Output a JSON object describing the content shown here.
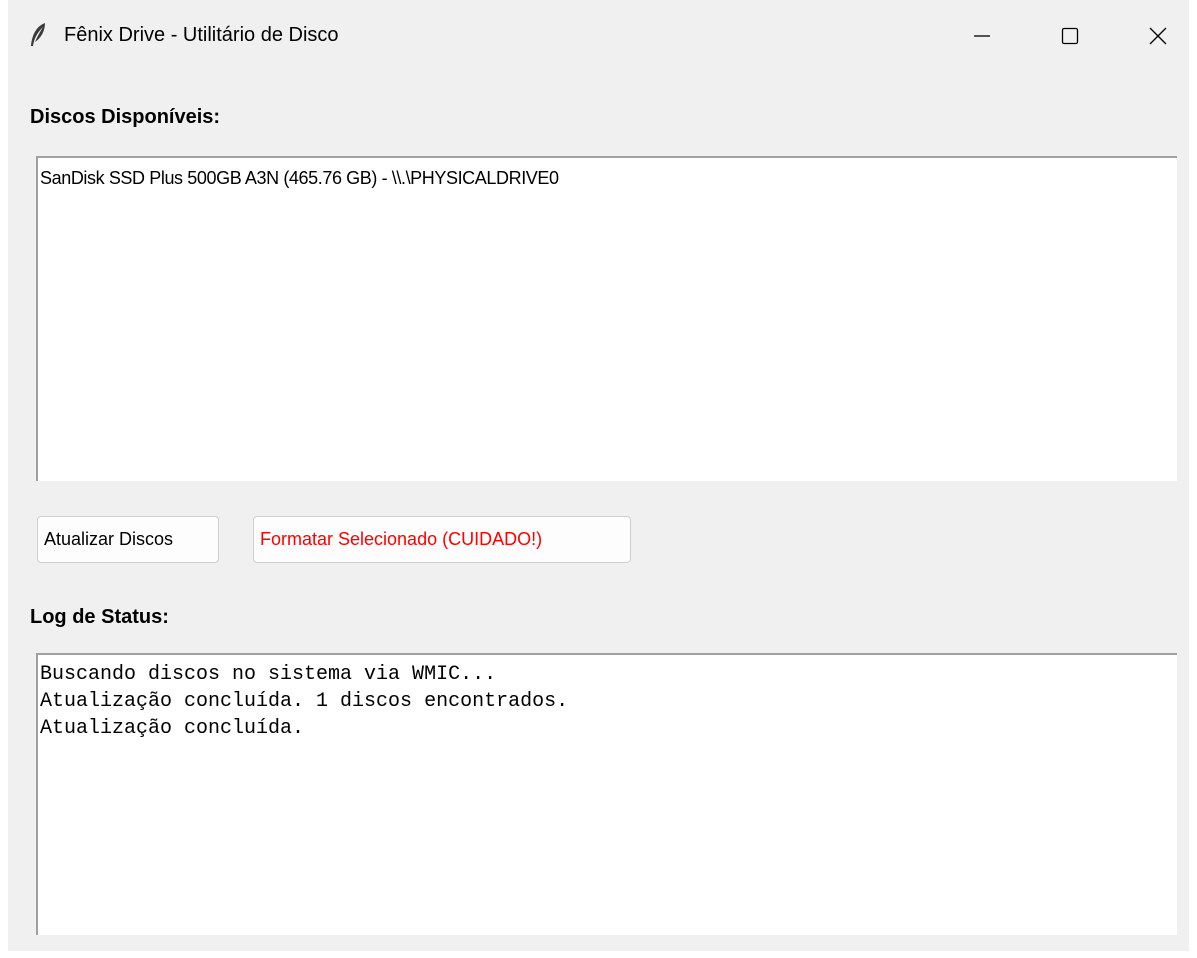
{
  "window": {
    "title": "Fênix Drive - Utilitário de Disco",
    "icon": "feather-icon",
    "controls": [
      "minimize-icon",
      "maximize-icon",
      "close-icon"
    ]
  },
  "disks": {
    "label": "Discos Disponíveis:",
    "items": [
      "SanDisk SSD Plus 500GB A3N (465.76 GB) - \\\\.\\PHYSICALDRIVE0"
    ]
  },
  "buttons": {
    "refresh_label": "Atualizar Discos",
    "format_label": "Formatar Selecionado (CUIDADO!)",
    "format_color": "#ff0000"
  },
  "log": {
    "label": "Log de Status:",
    "lines": [
      "Buscando discos no sistema via WMIC...",
      "Atualização concluída. 1 discos encontrados.",
      "Atualização concluída."
    ]
  }
}
